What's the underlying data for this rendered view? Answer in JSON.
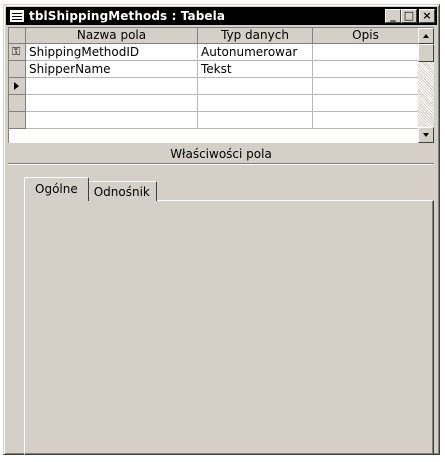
{
  "window": {
    "title": "tblShippingMethods : Tabela",
    "minimize_label": "_",
    "restore_label": "□",
    "close_label": "×"
  },
  "grid": {
    "columns": [
      "Nazwa pola",
      "Typ danych",
      "Opis"
    ],
    "rows": [
      {
        "field": "ShippingMethodID",
        "type": "Autonumerowar",
        "desc": "",
        "primary_key": true,
        "current": false
      },
      {
        "field": "ShipperName",
        "type": "Tekst",
        "desc": "",
        "primary_key": false,
        "current": false
      },
      {
        "field": "",
        "type": "",
        "desc": "",
        "primary_key": false,
        "current": true
      },
      {
        "field": "",
        "type": "",
        "desc": "",
        "primary_key": false,
        "current": false
      },
      {
        "field": "",
        "type": "",
        "desc": "",
        "primary_key": false,
        "current": false
      }
    ],
    "key_glyph": "⚿"
  },
  "properties": {
    "label": "Właściwości pola",
    "tabs": [
      {
        "label": "Ogólne",
        "active": true
      },
      {
        "label": "Odnośnik",
        "active": false
      }
    ]
  },
  "colors": {
    "face": "#d4d0c8",
    "titlebar": "#000000"
  }
}
